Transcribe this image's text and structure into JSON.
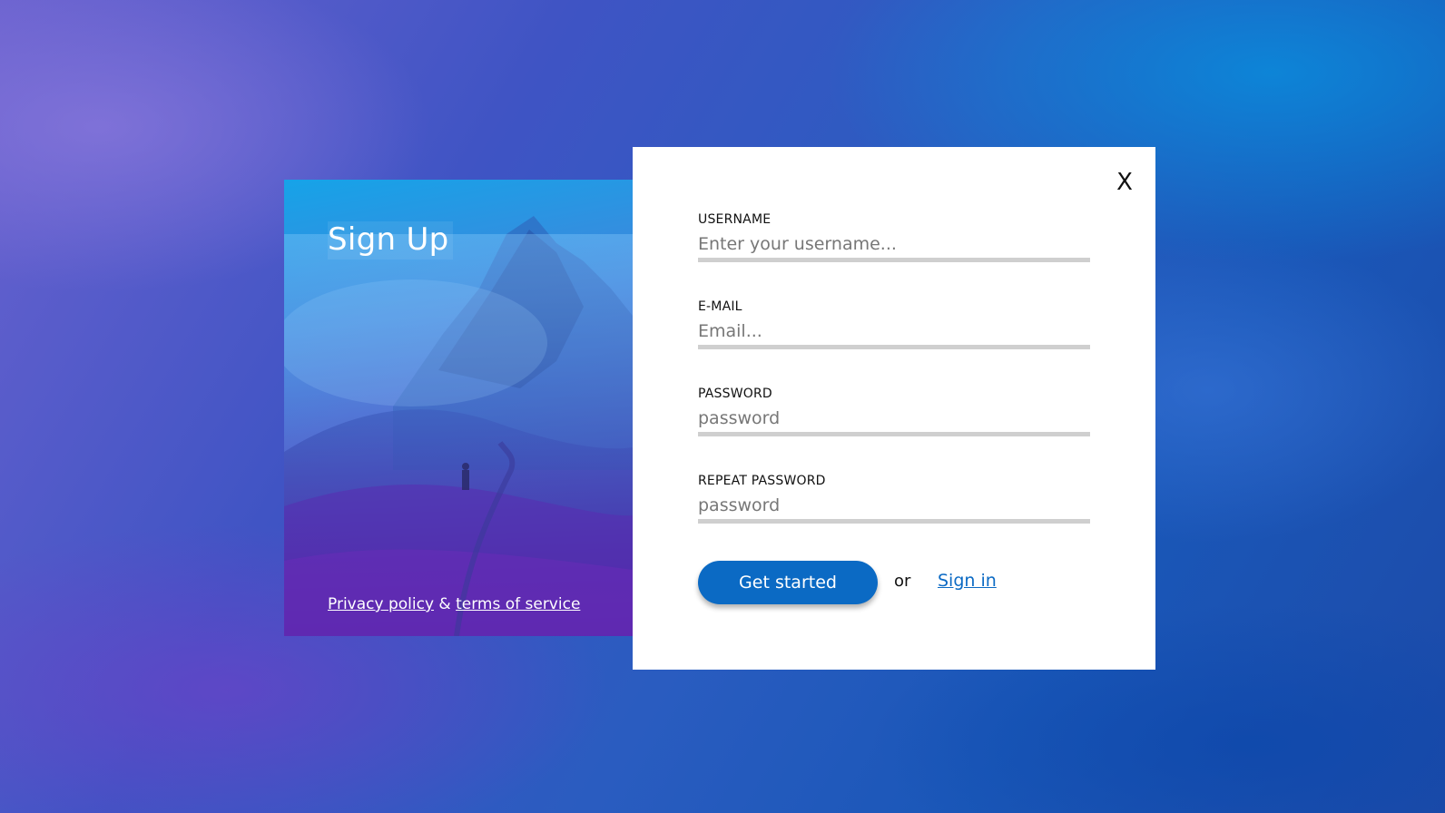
{
  "left_panel": {
    "title": "Sign Up",
    "privacy_link": "Privacy policy",
    "separator": "&",
    "terms_link": "terms of service"
  },
  "form": {
    "close_label": "X",
    "fields": [
      {
        "label": "USERNAME",
        "placeholder": "Enter your username...",
        "value": ""
      },
      {
        "label": "E-MAIL",
        "placeholder": "Email...",
        "value": ""
      },
      {
        "label": "PASSWORD",
        "placeholder": "password",
        "value": ""
      },
      {
        "label": "REPEAT PASSWORD",
        "placeholder": "password",
        "value": ""
      }
    ],
    "submit_label": "Get started",
    "or_text": "or",
    "sign_in_label": "Sign in"
  },
  "colors": {
    "accent": "#0b6ac4",
    "input_underline": "#cfcfcf",
    "card_background": "#ffffff"
  },
  "icons": {
    "close": "close-icon"
  }
}
